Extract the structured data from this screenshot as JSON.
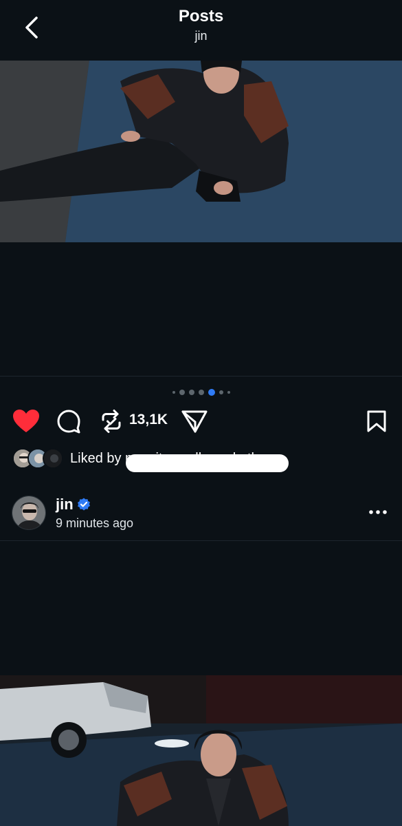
{
  "header": {
    "title": "Posts",
    "subtitle": "jin",
    "back_icon": "chevron-left-icon"
  },
  "carousel": {
    "total": 7,
    "active_index": 4
  },
  "actions": {
    "like_icon": "heart-filled-icon",
    "liked": true,
    "like_color": "#ff2d3a",
    "comment_icon": "comment-bubble-icon",
    "repost_icon": "repost-icon",
    "repost_count": "13,1K",
    "share_icon": "paper-plane-icon",
    "save_icon": "bookmark-icon"
  },
  "likes": {
    "text": "Liked by mamita_walla and others"
  },
  "author": {
    "name": "jin",
    "verified": true,
    "verified_color": "#2f7bf5",
    "time": "9 minutes ago",
    "more_icon": "more-horizontal-icon"
  },
  "colors": {
    "background": "#0b1116",
    "accent": "#2f7bf5"
  }
}
